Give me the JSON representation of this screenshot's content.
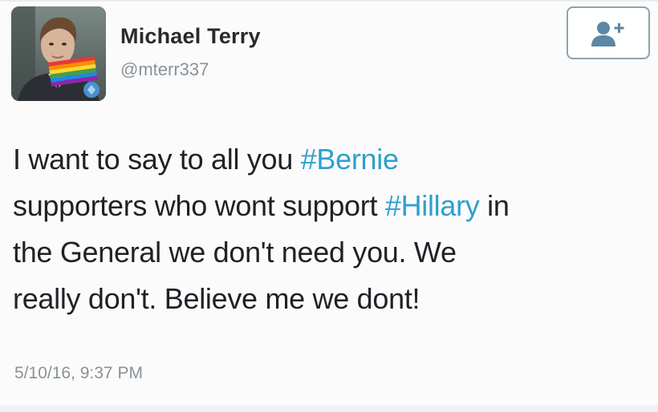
{
  "user": {
    "display_name": "Michael Terry",
    "handle": "@mterr337"
  },
  "follow_button": {
    "icon": "add-user-icon"
  },
  "tweet": {
    "line1_pre": "I want to say to all you ",
    "hashtag1": "#Bernie",
    "line2_pre": "supporters who wont support ",
    "hashtag2": "#Hillary",
    "line2_post": " in",
    "line3": "the General we don't need you. We",
    "line4": "really don't. Believe me we dont!",
    "timestamp": "5/10/16, 9:37 PM"
  },
  "colors": {
    "hashtag": "#2f9fcf",
    "secondary_text": "#8a9298",
    "button_border": "#8da3b0",
    "primary_text": "#1e2226"
  }
}
